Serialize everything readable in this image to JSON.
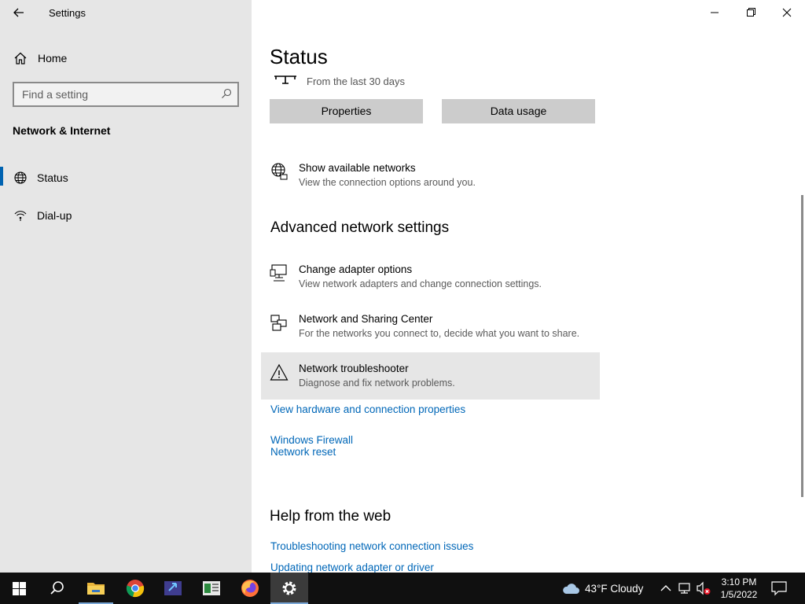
{
  "window": {
    "app_title": "Settings"
  },
  "sidebar": {
    "home_label": "Home",
    "search_placeholder": "Find a setting",
    "section_heading": "Network & Internet",
    "items": [
      {
        "label": "Status",
        "icon": "globe-icon",
        "active": true
      },
      {
        "label": "Dial-up",
        "icon": "dialup-icon",
        "active": false
      }
    ]
  },
  "main": {
    "page_title": "Status",
    "usage_text": "From the last 30 days",
    "buttons": {
      "properties": "Properties",
      "data_usage": "Data usage"
    },
    "show_networks": {
      "title": "Show available networks",
      "desc": "View the connection options around you."
    },
    "advanced_heading": "Advanced network settings",
    "advanced_items": [
      {
        "title": "Change adapter options",
        "desc": "View network adapters and change connection settings.",
        "icon": "adapter-icon"
      },
      {
        "title": "Network and Sharing Center",
        "desc": "For the networks you connect to, decide what you want to share.",
        "icon": "sharing-center-icon"
      },
      {
        "title": "Network troubleshooter",
        "desc": "Diagnose and fix network problems.",
        "icon": "warning-icon"
      }
    ],
    "links": {
      "hardware": "View hardware and connection properties",
      "firewall": "Windows Firewall",
      "reset": "Network reset"
    },
    "help_heading": "Help from the web",
    "help_links": {
      "troubleshooting": "Troubleshooting network connection issues",
      "updating": "Updating network adapter or driver"
    }
  },
  "taskbar": {
    "weather": "43°F  Cloudy",
    "time": "3:10 PM",
    "date": "1/5/2022"
  },
  "colors": {
    "accent": "#0063b1",
    "link": "#0067b8",
    "sidebar_bg": "#e6e6e6",
    "taskbar_bg": "#101010"
  }
}
